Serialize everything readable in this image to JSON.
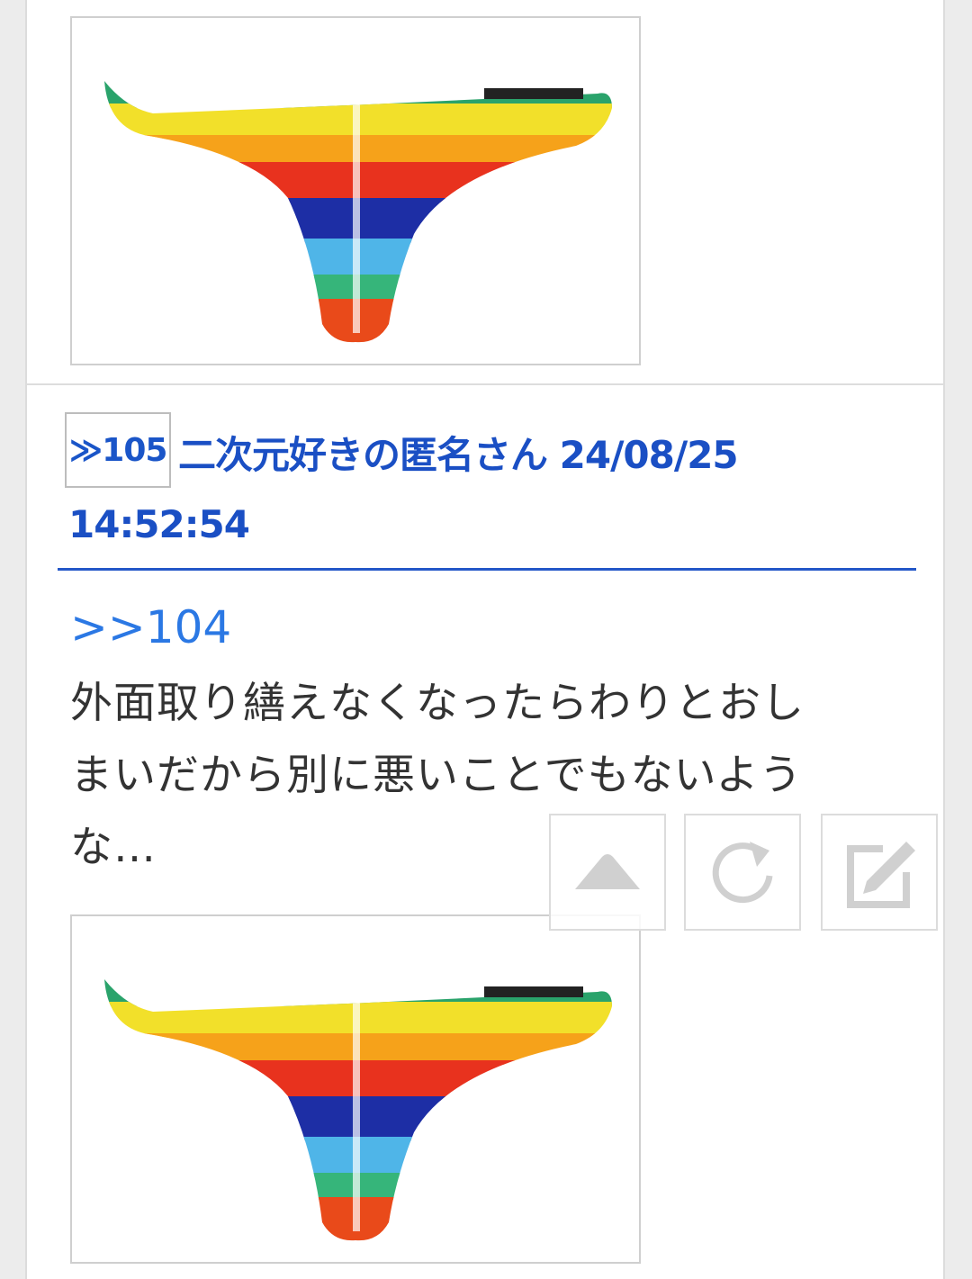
{
  "post": {
    "res_number": "≫105",
    "name_date": "二次元好きの匿名さん 24/08/25",
    "time": "14:52:54",
    "reply_anchor": ">>104",
    "body_lines": [
      "外面取り繕えなくなったらわりとおし",
      "まいだから別に悪いことでもないよう",
      "な…"
    ]
  },
  "floating_buttons": [
    {
      "name": "scroll-top",
      "icon": "triangle-up-icon"
    },
    {
      "name": "reload",
      "icon": "refresh-icon"
    },
    {
      "name": "write",
      "icon": "edit-icon"
    }
  ],
  "colors": {
    "link_blue": "#2b78e4",
    "header_blue": "#1a4fc4",
    "text": "#333333",
    "icon_gray": "#d0d0d0"
  }
}
